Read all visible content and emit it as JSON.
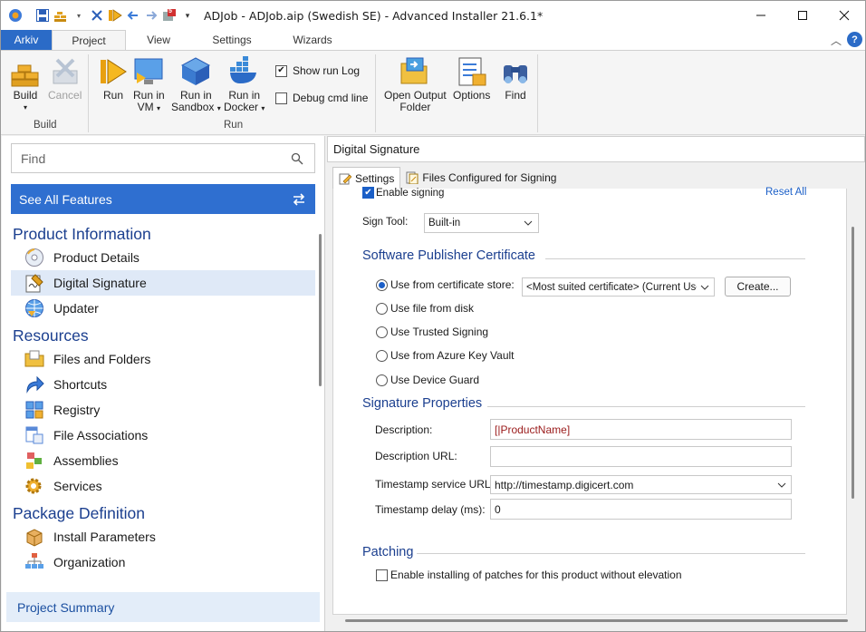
{
  "window": {
    "title": "ADJob - ADJob.aip (Swedish SE) - Advanced Installer 21.6.1*",
    "quick_access_icons": [
      "app-logo-icon",
      "save-icon",
      "build-icon",
      "clean-icon",
      "run-icon",
      "back-icon",
      "forward-icon",
      "notifications-icon",
      "customize-qat-icon"
    ],
    "notification_count": "5"
  },
  "ribbon_tabs": [
    {
      "label": "Arkiv"
    },
    {
      "label": "Project"
    },
    {
      "label": "View"
    },
    {
      "label": "Settings"
    },
    {
      "label": "Wizards"
    }
  ],
  "ribbon": {
    "build_group": {
      "label": "Build",
      "build": "Build",
      "cancel": "Cancel"
    },
    "run_group": {
      "label": "Run",
      "run": "Run",
      "run_in_vm_l1": "Run in",
      "run_in_vm_l2": "VM",
      "run_in_sandbox_l1": "Run in",
      "run_in_sandbox_l2": "Sandbox",
      "run_in_docker_l1": "Run in",
      "run_in_docker_l2": "Docker",
      "show_run_log": "Show run Log",
      "show_run_log_checked": true,
      "debug_cmd_line": "Debug cmd line",
      "debug_cmd_line_checked": false
    },
    "other": {
      "open_output_l1": "Open Output",
      "open_output_l2": "Folder",
      "options": "Options",
      "find": "Find"
    }
  },
  "left_panel": {
    "search_placeholder": "Find",
    "see_all_features": "See All Features",
    "categories": [
      {
        "label": "Product Information",
        "items": [
          "Product Details",
          "Digital Signature",
          "Updater"
        ]
      },
      {
        "label": "Resources",
        "items": [
          "Files and Folders",
          "Shortcuts",
          "Registry",
          "File Associations",
          "Assemblies",
          "Services"
        ]
      },
      {
        "label": "Package Definition",
        "items": [
          "Install Parameters",
          "Organization"
        ]
      }
    ],
    "selected_item": "Digital Signature",
    "project_summary": "Project Summary"
  },
  "right_panel": {
    "title": "Digital Signature",
    "tabs": [
      "Settings",
      "Files Configured for Signing"
    ],
    "enable_signing": "Enable signing",
    "enable_signing_checked": true,
    "reset_all": "Reset All",
    "sign_tool_label": "Sign Tool:",
    "sign_tool_value": "Built-in",
    "certificate_section": "Software Publisher Certificate",
    "certificate_options": [
      "Use from certificate store:",
      "Use file from disk",
      "Use Trusted Signing",
      "Use from Azure Key Vault",
      "Use Device Guard"
    ],
    "certificate_selected": 0,
    "certificate_store_value": "<Most suited certificate> (Current User",
    "create_button": "Create...",
    "properties_section": "Signature Properties",
    "description_label": "Description:",
    "description_value": "[|ProductName]",
    "description_url_label": "Description URL:",
    "description_url_value": "",
    "timestamp_url_label": "Timestamp service URL:",
    "timestamp_url_value": "http://timestamp.digicert.com",
    "timestamp_delay_label": "Timestamp delay (ms):",
    "timestamp_delay_value": "0",
    "patching_section": "Patching",
    "patching_option": "Enable installing of patches for this product without elevation",
    "patching_checked": false
  },
  "colors": {
    "accent": "#2f6fd0",
    "file_tab": "#2b6bc7",
    "category_text": "#1b3f8f",
    "selection": "#dfe9f7",
    "description_text": "#9a1a1a"
  }
}
